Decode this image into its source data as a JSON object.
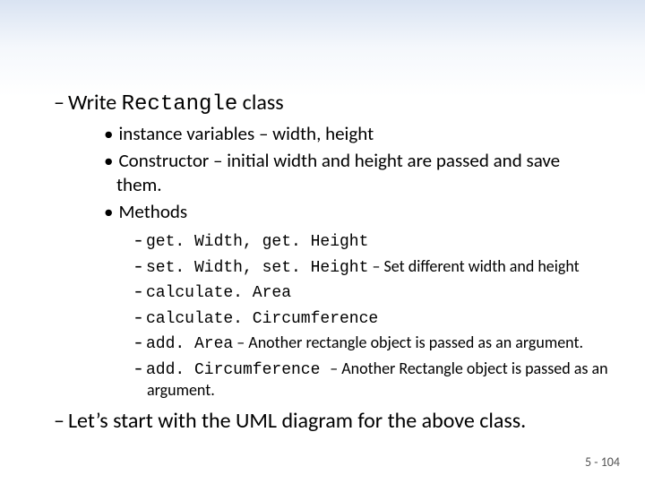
{
  "l1a_pre": "Write ",
  "l1a_code": "Rectangle",
  "l1a_post": " class",
  "b1": "instance variables – width, height",
  "b2": "Constructor – initial width and height are passed and save them.",
  "b3": "Methods",
  "m1": "get. Width, get. Height",
  "m2_code": "set. Width, set. Height",
  "m2_post": " – Set different width and height",
  "m3": "calculate. Area",
  "m4": "calculate. Circumference",
  "m5_code": "add. Area",
  "m5_post": " – Another rectangle object is passed as an argument.",
  "m6_code": "add. Circumference ",
  "m6_post": " – Another Rectangle object is passed as an argument.",
  "l1b": "Let’s start with the UML diagram for the above class.",
  "page": "5 - 104"
}
